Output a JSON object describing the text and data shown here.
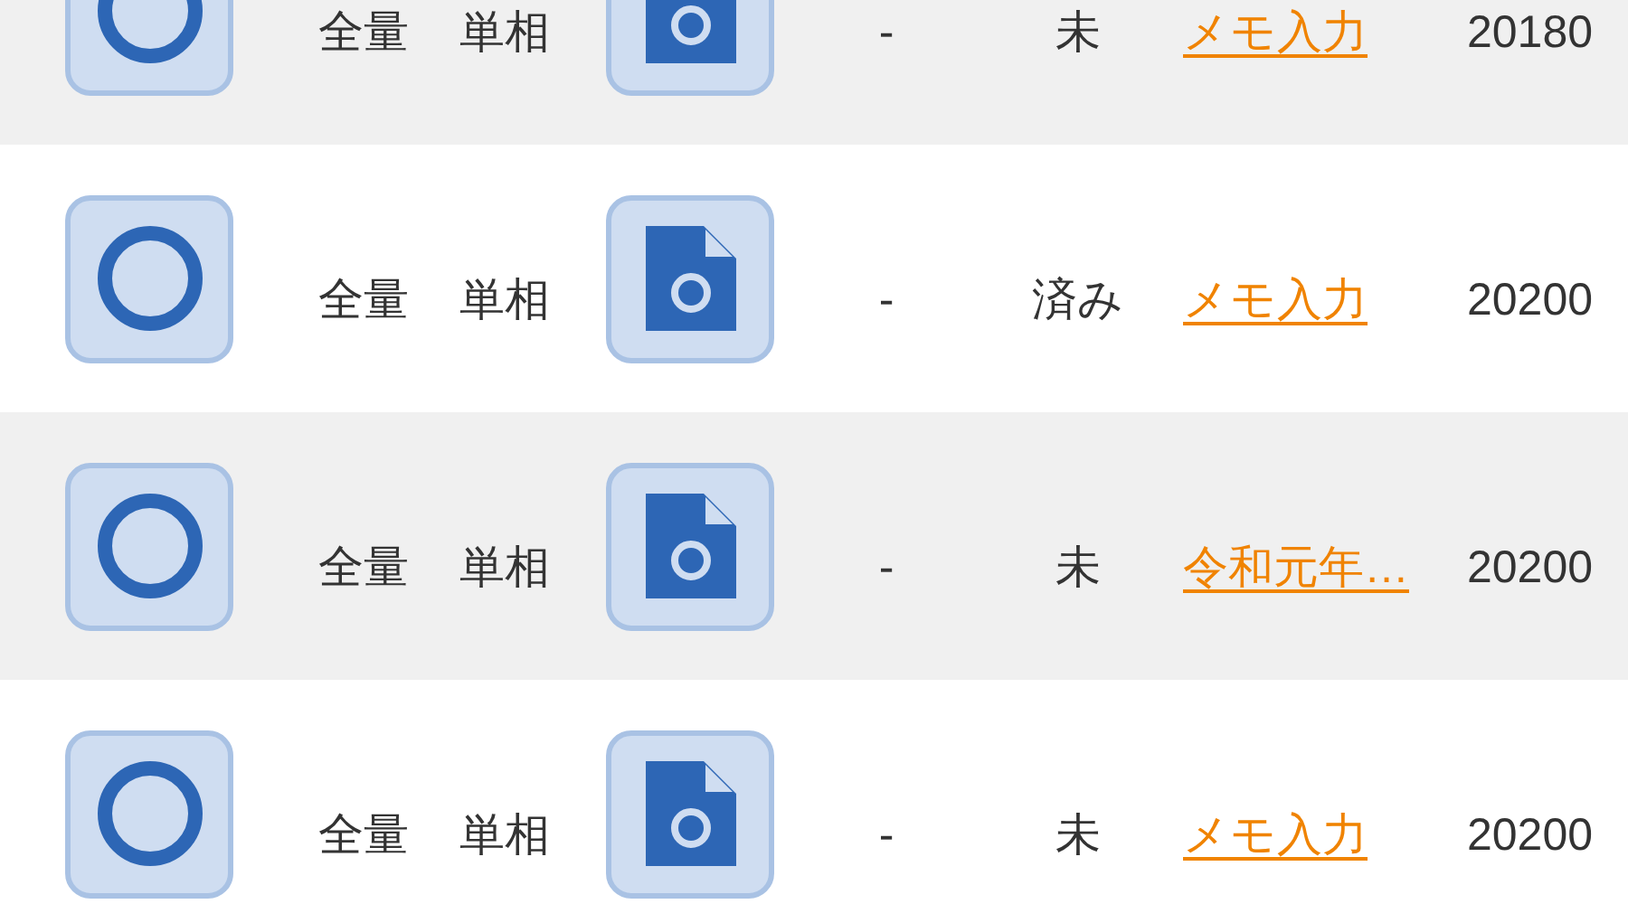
{
  "rows": [
    {
      "capacity": "全量",
      "phase": "単相",
      "dash": "-",
      "status": "未",
      "memo": "メモ入力",
      "date": "20180"
    },
    {
      "capacity": "全量",
      "phase": "単相",
      "dash": "-",
      "status": "済み",
      "memo": "メモ入力",
      "date": "20200"
    },
    {
      "capacity": "全量",
      "phase": "単相",
      "dash": "-",
      "status": "未",
      "memo": "令和元年…",
      "date": "20200"
    },
    {
      "capacity": "全量",
      "phase": "単相",
      "dash": "-",
      "status": "未",
      "memo": "メモ入力",
      "date": "20200"
    }
  ]
}
